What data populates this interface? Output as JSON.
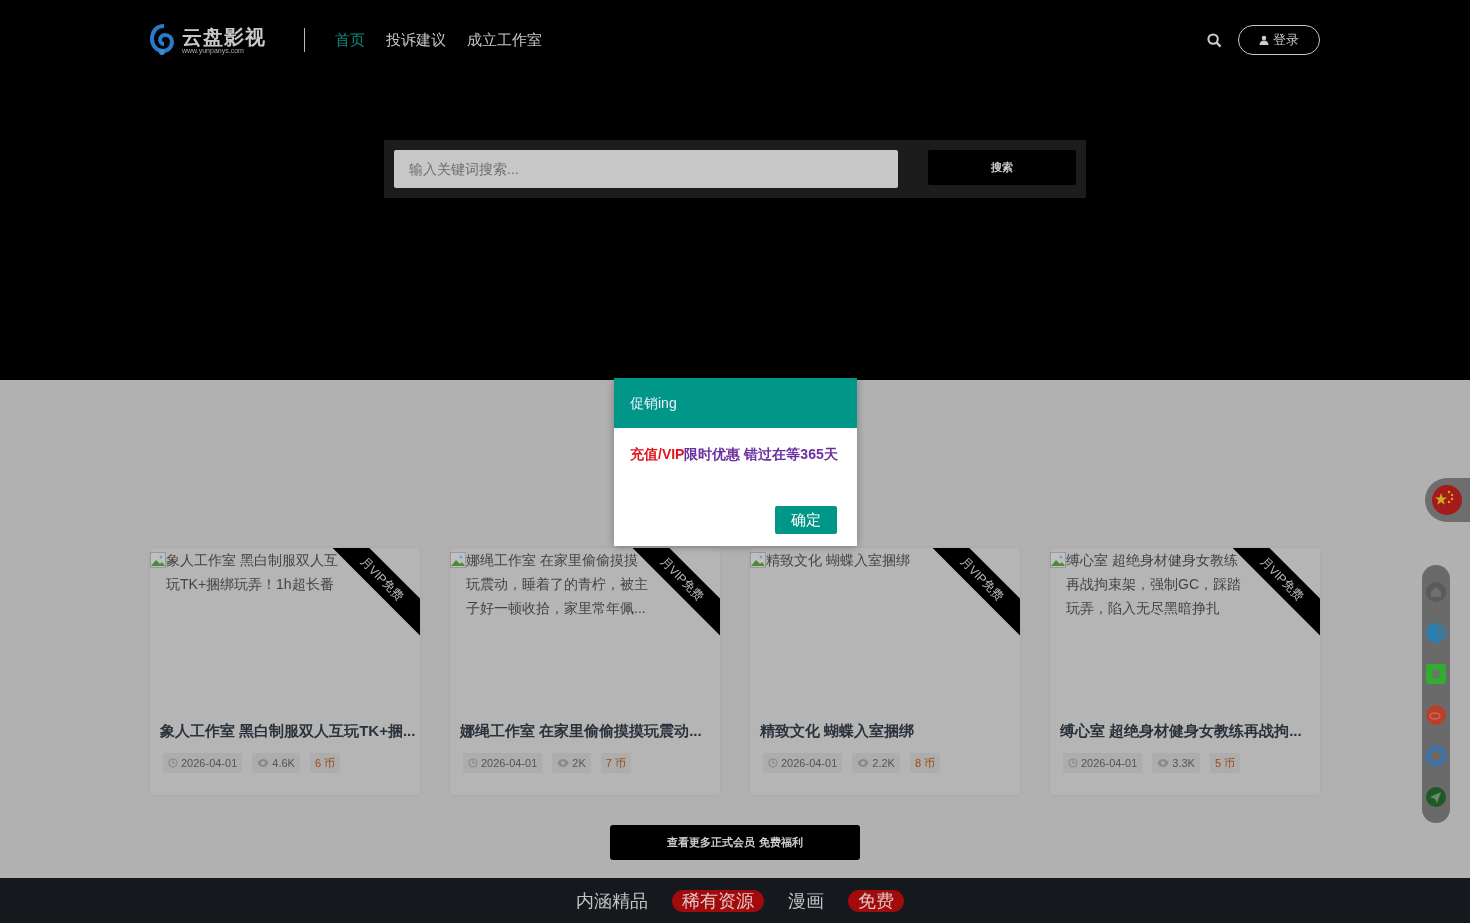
{
  "nav": {
    "logo_name": "云盘影视",
    "logo_url": "www.yunpanys.com",
    "links": [
      {
        "label": "首页",
        "selected": true
      },
      {
        "label": "投诉建议",
        "selected": false
      },
      {
        "label": "成立工作室",
        "selected": false
      }
    ],
    "login": "登录"
  },
  "search": {
    "placeholder": "输入关键词搜索...",
    "button": "搜索"
  },
  "cards": [
    {
      "alt": "象人工作室 黑白制服双人互玩TK+捆绑玩弄！1h超长番",
      "ribbon": "月VIP免费",
      "title": "象人工作室 黑白制服双人互玩TK+捆...",
      "date": "2026-04-01",
      "views": "4.6K",
      "price": "6 币"
    },
    {
      "alt": "娜绳工作室 在家里偷偷摸摸玩震动，睡着了的青柠，被主子好一顿收拾，家里常年佩...",
      "ribbon": "月VIP免费",
      "title": "娜绳工作室 在家里偷偷摸摸玩震动...",
      "date": "2026-04-01",
      "views": "2K",
      "price": "7 币"
    },
    {
      "alt": "精致文化 蝴蝶入室捆绑",
      "ribbon": "月VIP免费",
      "title": "精致文化 蝴蝶入室捆绑",
      "date": "2026-04-01",
      "views": "2.2K",
      "price": "8 币"
    },
    {
      "alt": "缚心室 超绝身材健身女教练再战拘束架，强制GC，踩踏玩弄，陷入无尽黑暗挣扎",
      "ribbon": "月VIP免费",
      "title": "缚心室 超绝身材健身女教练再战拘...",
      "date": "2026-04-01",
      "views": "3.3K",
      "price": "5 币"
    }
  ],
  "more_button": "查看更多正式会员 免费福利",
  "footer_links": [
    {
      "label": "内涵精品",
      "highlighted": false
    },
    {
      "label": "稀有资源",
      "highlighted": true
    },
    {
      "label": "漫画",
      "highlighted": false
    },
    {
      "label": "免费",
      "highlighted": true
    }
  ],
  "modal": {
    "title": "促销ing",
    "message": [
      {
        "text": "充值/VIP",
        "color": "#e0141e"
      },
      {
        "text": "限时优惠 错过在等365天",
        "color": "#6b2fa0"
      }
    ],
    "button": "确定"
  }
}
